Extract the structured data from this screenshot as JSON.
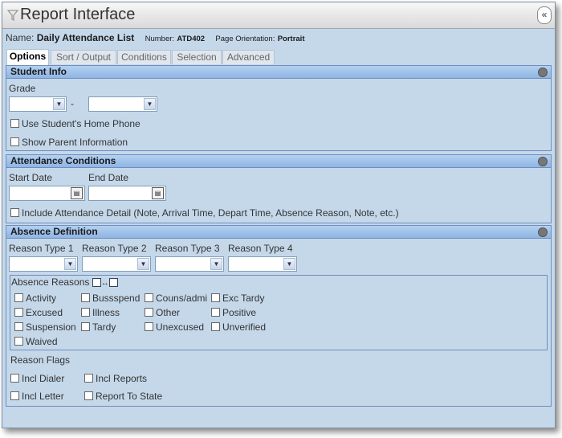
{
  "title": "Report Interface",
  "name_label": "Name:",
  "name_value": "Daily Attendance List",
  "number_label": "Number:",
  "number_value": "ATD402",
  "orientation_label": "Page Orientation:",
  "orientation_value": "Portrait",
  "tabs": [
    "Options",
    "Sort / Output",
    "Conditions",
    "Selection",
    "Advanced"
  ],
  "student_info": {
    "header": "Student Info",
    "grade_label": "Grade",
    "grade_from": "",
    "grade_to": "",
    "grade_separator": "-",
    "use_home_phone": "Use Student's Home Phone",
    "show_parent": "Show Parent Information"
  },
  "attendance_conditions": {
    "header": "Attendance Conditions",
    "start_label": "Start Date",
    "end_label": "End Date",
    "include_detail": "Include Attendance Detail (Note, Arrival Time, Depart Time, Absence Reason, Note, etc.)"
  },
  "absence_definition": {
    "header": "Absence Definition",
    "reason_types": [
      "Reason Type 1",
      "Reason Type 2",
      "Reason Type 3",
      "Reason Type 4"
    ],
    "reasons_label": "Absence Reasons",
    "reasons": [
      "Activity",
      "Bussspend",
      "Couns/admi",
      "Exc Tardy",
      "Excused",
      "Illness",
      "Other",
      "Positive",
      "Suspension",
      "Tardy",
      "Unexcused",
      "Unverified",
      "Waived"
    ],
    "flags_label": "Reason Flags",
    "flags": [
      "Incl Dialer",
      "Incl Reports",
      "Incl Letter",
      "Report To State"
    ]
  }
}
